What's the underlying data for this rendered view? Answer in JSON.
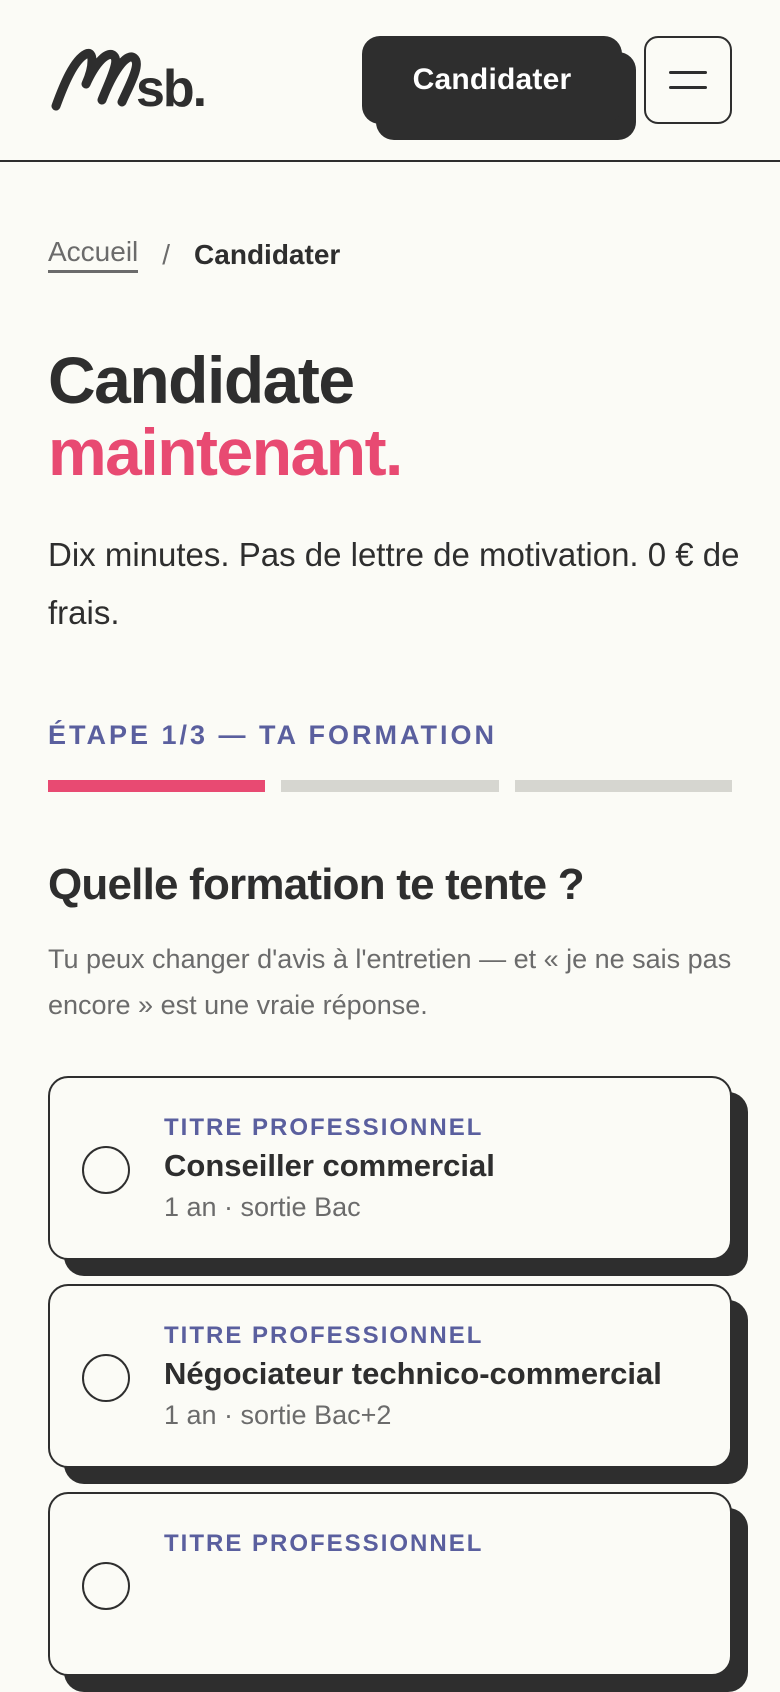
{
  "header": {
    "logo_text": "Msb.",
    "cta_label": "Candidater",
    "menu_icon": "hamburger-menu-icon"
  },
  "breadcrumb": {
    "home": "Accueil",
    "separator": "/",
    "current": "Candidater"
  },
  "hero": {
    "title_line1": "Candidate",
    "title_line2": "maintenant.",
    "subtitle": "Dix minutes. Pas de lettre de motivation. 0 € de frais."
  },
  "step": {
    "label": "ÉTAPE 1/3 — TA FORMATION",
    "current": 1,
    "total": 3
  },
  "question": {
    "title": "Quelle formation te tente ?",
    "help": "Tu peux changer d'avis à l'entretien — et « je ne sais pas encore » est une vraie réponse."
  },
  "options": [
    {
      "kicker": "TITRE PROFESSIONNEL",
      "name": "Conseiller commercial",
      "meta": "1 an · sortie Bac"
    },
    {
      "kicker": "TITRE PROFESSIONNEL",
      "name": "Négociateur technico-commercial",
      "meta": "1 an · sortie Bac+2"
    },
    {
      "kicker": "TITRE PROFESSIONNEL",
      "name": "",
      "meta": ""
    }
  ],
  "colors": {
    "accent": "#e84a72",
    "ink": "#2e2e2e",
    "kicker": "#5a5f9e",
    "muted": "#6b6b6b",
    "background": "#fbfbf6",
    "track": "#d6d6d0"
  }
}
